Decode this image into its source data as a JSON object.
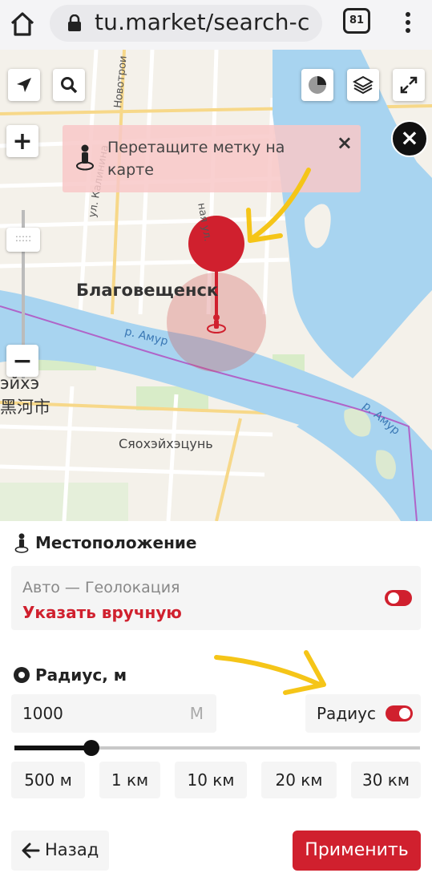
{
  "browser": {
    "url": "tu.market/search-c",
    "tab_count": "81"
  },
  "map": {
    "hint_text": "Перетащите метку на карте",
    "city_label": "Благовещенск",
    "town_label": "Сяохэйхэцунь",
    "chinese_label_1": "эйхэ",
    "chinese_label_2": "黑河市",
    "river_label": "р. Амур",
    "street_kalinina": "ул. Калинина",
    "street_novotroitskaya": "Новотрои",
    "street_third": "ная ул.",
    "zoom_in": "+",
    "zoom_out": "−",
    "zoom_handle": ":::::",
    "close_symbol": "×"
  },
  "location": {
    "title": "Местоположение",
    "mode_text": "Авто — Геолокация",
    "manual_link": "Указать вручную"
  },
  "radius": {
    "title": "Радиус, м",
    "value": "1000",
    "unit": "М",
    "toggle_label": "Радиус",
    "slider_fraction": 0.19,
    "presets": [
      "500 м",
      "1 км",
      "10 км",
      "20 км",
      "30 км"
    ]
  },
  "actions": {
    "back_label": "Назад",
    "apply_label": "Применить"
  },
  "colors": {
    "accent": "#d0202e",
    "river": "#a8d4f0",
    "annotation": "#f5c518"
  },
  "icons": [
    "home-icon",
    "lock-icon",
    "tabs-icon",
    "menu-icon",
    "location-arrow-icon",
    "search-icon",
    "theme-icon",
    "layers-icon",
    "expand-icon",
    "person-pin-icon",
    "map-pin-icon",
    "radio-icon",
    "back-arrow-icon"
  ]
}
